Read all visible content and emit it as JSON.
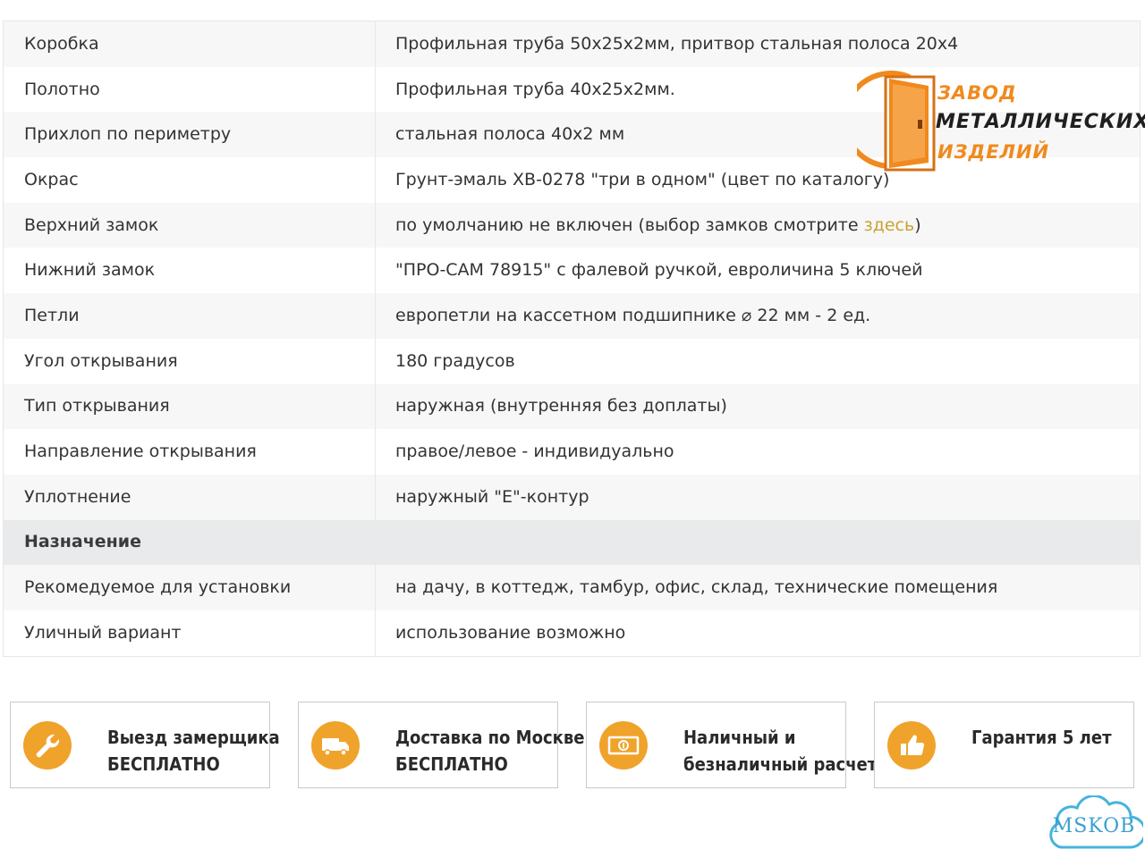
{
  "specs": {
    "rows": [
      {
        "label": "Коробка",
        "value": "Профильная труба 50x25x2мм, притвор стальная полоса 20х4"
      },
      {
        "label": "Полотно",
        "value": "Профильная труба 40x25x2мм."
      },
      {
        "label": "Прихлоп по периметру",
        "value": "стальная полоса 40х2 мм"
      },
      {
        "label": "Окрас",
        "value": "Грунт-эмаль ХВ-0278 \"три в одном\" (цвет по каталогу)"
      },
      {
        "label": "Верхний замок",
        "value_before": "по умолчанию не включен (выбор замков смотрите ",
        "link": "здесь",
        "value_after": ")"
      },
      {
        "label": "Нижний замок",
        "value": "\"ПРО-САМ 78915\" с фалевой ручкой, евроличина 5 ключей"
      },
      {
        "label": "Петли",
        "value": "европетли на кассетном подшипнике ⌀ 22 мм - 2 ед."
      },
      {
        "label": "Угол открывания",
        "value": "180 градусов"
      },
      {
        "label": "Тип открывания",
        "value": "наружная (внутренняя без доплаты)"
      },
      {
        "label": "Направление открывания",
        "value": "правое/левое - индивидуально"
      },
      {
        "label": "Уплотнение",
        "value": "наружный \"Е\"-контур"
      },
      {
        "section": "Назначение"
      },
      {
        "label": "Рекомедуемое для установки",
        "value": "на дачу, в коттедж, тамбур, офис, склад, технические помещения"
      },
      {
        "label": "Уличный вариант",
        "value": "использование возможно"
      }
    ]
  },
  "logo": {
    "line1": "ЗАВОД",
    "line2": "МЕТАЛЛИЧЕСКИХ",
    "line3": "ИЗДЕЛИЙ"
  },
  "features": [
    {
      "icon": "wrench-icon",
      "line1": "Выезд замерщика",
      "line2": "БЕСПЛАТНО"
    },
    {
      "icon": "truck-icon",
      "line1": "Доставка по Москве",
      "line2": "БЕСПЛАТНО"
    },
    {
      "icon": "money-icon",
      "line1": "Наличный и",
      "line2": "безналичный расчет"
    },
    {
      "icon": "thumbs-up-icon",
      "line1": "Гарантия 5 лет",
      "line2": ""
    }
  ],
  "watermark": "MSKOB",
  "colors": {
    "accent": "#f0a32a",
    "link": "#c9a233",
    "logo_orange": "#f08a1e",
    "badge": "#3aa0cf"
  }
}
